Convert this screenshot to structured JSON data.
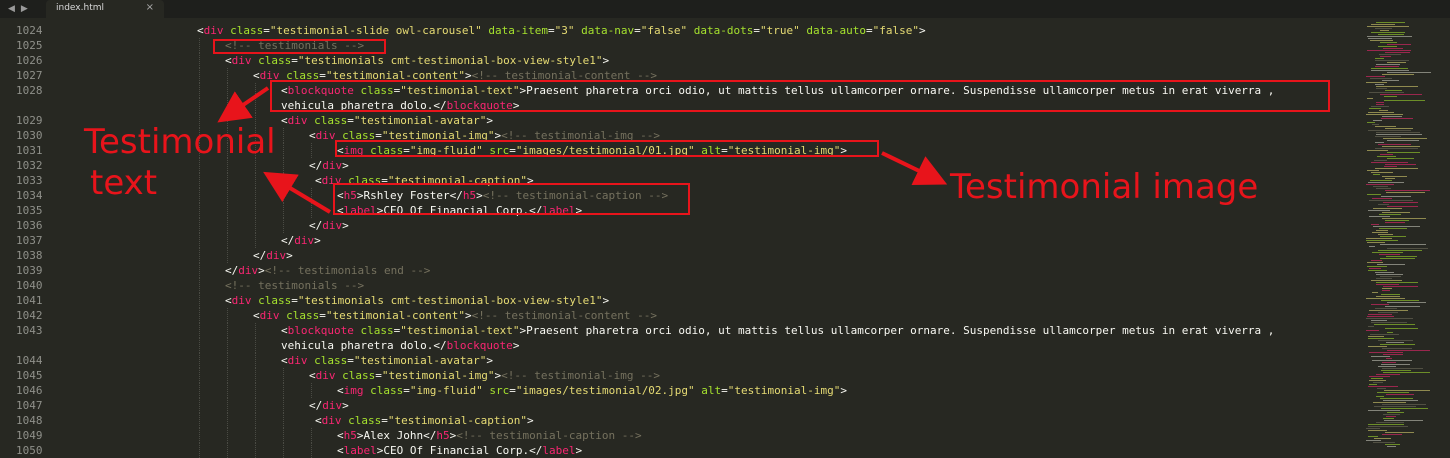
{
  "tab": {
    "title": "index.html",
    "close": "×"
  },
  "nav": {
    "back": "◀",
    "forward": "▶"
  },
  "line_numbers": [
    "1024",
    "1025",
    "1026",
    "1027",
    "1028",
    "1029",
    "1030",
    "1031",
    "1032",
    "1033",
    "1034",
    "1035",
    "1036",
    "1037",
    "1038",
    "1039",
    "1040",
    "1041",
    "1042",
    "1043",
    "1044",
    "1045",
    "1046",
    "1047",
    "1048",
    "1049",
    "1050"
  ],
  "code_lines": [
    {
      "indent": 1,
      "tokens": [
        [
          "t",
          "<"
        ],
        [
          "tag",
          "div"
        ],
        [
          "t",
          " "
        ],
        [
          "attr",
          "class"
        ],
        [
          "t",
          "="
        ],
        [
          "str",
          "\"testimonial-slide owl-carousel\""
        ],
        [
          "t",
          " "
        ],
        [
          "attr",
          "data-item"
        ],
        [
          "t",
          "="
        ],
        [
          "str",
          "\"3\""
        ],
        [
          "t",
          " "
        ],
        [
          "attr",
          "data-nav"
        ],
        [
          "t",
          "="
        ],
        [
          "str",
          "\"false\""
        ],
        [
          "t",
          " "
        ],
        [
          "attr",
          "data-dots"
        ],
        [
          "t",
          "="
        ],
        [
          "str",
          "\"true\""
        ],
        [
          "t",
          " "
        ],
        [
          "attr",
          "data-auto"
        ],
        [
          "t",
          "="
        ],
        [
          "str",
          "\"false\""
        ],
        [
          "t",
          ">"
        ]
      ]
    },
    {
      "indent": 2,
      "tokens": [
        [
          "com",
          "<!-- testimonials -->"
        ]
      ]
    },
    {
      "indent": 2,
      "tokens": [
        [
          "t",
          "<"
        ],
        [
          "tag",
          "div"
        ],
        [
          "t",
          " "
        ],
        [
          "attr",
          "class"
        ],
        [
          "t",
          "="
        ],
        [
          "str",
          "\"testimonials cmt-testimonial-box-view-style1\""
        ],
        [
          "t",
          ">"
        ]
      ]
    },
    {
      "indent": 3,
      "tokens": [
        [
          "t",
          "<"
        ],
        [
          "tag",
          "div"
        ],
        [
          "t",
          " "
        ],
        [
          "attr",
          "class"
        ],
        [
          "t",
          "="
        ],
        [
          "str",
          "\"testimonial-content\""
        ],
        [
          "t",
          ">"
        ],
        [
          "com",
          "<!-- testimonial-content -->"
        ]
      ]
    },
    {
      "indent": 4,
      "tokens": [
        [
          "t",
          "<"
        ],
        [
          "tag",
          "blockquote"
        ],
        [
          "t",
          " "
        ],
        [
          "attr",
          "class"
        ],
        [
          "t",
          "="
        ],
        [
          "str",
          "\"testimonial-text\""
        ],
        [
          "t",
          ">Praesent pharetra orci odio, ut mattis tellus ullamcorper ornare. Suspendisse ullamcorper metus in erat viverra ,"
        ]
      ]
    },
    {
      "indent": 4,
      "wrap": true,
      "tokens": [
        [
          "t",
          "vehicula pharetra dolo.</"
        ],
        [
          "tag",
          "blockquote"
        ],
        [
          "t",
          ">"
        ]
      ]
    },
    {
      "indent": 4,
      "tokens": [
        [
          "t",
          "<"
        ],
        [
          "tag",
          "div"
        ],
        [
          "t",
          " "
        ],
        [
          "attr",
          "class"
        ],
        [
          "t",
          "="
        ],
        [
          "str",
          "\"testimonial-avatar\""
        ],
        [
          "t",
          ">"
        ]
      ]
    },
    {
      "indent": 5,
      "tokens": [
        [
          "t",
          "<"
        ],
        [
          "tag",
          "div"
        ],
        [
          "t",
          " "
        ],
        [
          "attr",
          "class"
        ],
        [
          "t",
          "="
        ],
        [
          "str",
          "\"testimonial-img\""
        ],
        [
          "t",
          ">"
        ],
        [
          "com",
          "<!-- testimonial-img -->"
        ]
      ]
    },
    {
      "indent": 6,
      "tokens": [
        [
          "t",
          "<"
        ],
        [
          "tag",
          "img"
        ],
        [
          "t",
          " "
        ],
        [
          "attr",
          "class"
        ],
        [
          "t",
          "="
        ],
        [
          "str",
          "\"img-fluid\""
        ],
        [
          "t",
          " "
        ],
        [
          "attr",
          "src"
        ],
        [
          "t",
          "="
        ],
        [
          "str",
          "\"images/testimonial/01.jpg\""
        ],
        [
          "t",
          " "
        ],
        [
          "attr",
          "alt"
        ],
        [
          "t",
          "="
        ],
        [
          "str",
          "\"testimonial-img\""
        ],
        [
          "t",
          ">"
        ]
      ]
    },
    {
      "indent": 5,
      "tokens": [
        [
          "t",
          "</"
        ],
        [
          "tag",
          "div"
        ],
        [
          "t",
          ">"
        ]
      ]
    },
    {
      "indent": 5,
      "extra": 6,
      "tokens": [
        [
          "t",
          "<"
        ],
        [
          "tag",
          "div"
        ],
        [
          "t",
          " "
        ],
        [
          "attr",
          "class"
        ],
        [
          "t",
          "="
        ],
        [
          "str",
          "\"testimonial-caption\""
        ],
        [
          "t",
          ">"
        ]
      ]
    },
    {
      "indent": 6,
      "tokens": [
        [
          "t",
          "<"
        ],
        [
          "tag",
          "h5"
        ],
        [
          "t",
          ">Rshley Foster</"
        ],
        [
          "tag",
          "h5"
        ],
        [
          "t",
          ">"
        ],
        [
          "com",
          "<!-- testimonial-caption -->"
        ]
      ]
    },
    {
      "indent": 6,
      "tokens": [
        [
          "t",
          "<"
        ],
        [
          "tag",
          "label"
        ],
        [
          "t",
          ">CEO Of Financial Corp.</"
        ],
        [
          "tag",
          "label"
        ],
        [
          "t",
          ">"
        ]
      ]
    },
    {
      "indent": 5,
      "tokens": [
        [
          "t",
          "</"
        ],
        [
          "tag",
          "div"
        ],
        [
          "t",
          ">"
        ]
      ]
    },
    {
      "indent": 4,
      "tokens": [
        [
          "t",
          "</"
        ],
        [
          "tag",
          "div"
        ],
        [
          "t",
          ">"
        ]
      ]
    },
    {
      "indent": 3,
      "tokens": [
        [
          "t",
          "</"
        ],
        [
          "tag",
          "div"
        ],
        [
          "t",
          ">"
        ]
      ]
    },
    {
      "indent": 2,
      "tokens": [
        [
          "t",
          "</"
        ],
        [
          "tag",
          "div"
        ],
        [
          "t",
          ">"
        ],
        [
          "com",
          "<!-- testimonials end -->"
        ]
      ]
    },
    {
      "indent": 2,
      "tokens": [
        [
          "com",
          "<!-- testimonials -->"
        ]
      ]
    },
    {
      "indent": 2,
      "tokens": [
        [
          "t",
          "<"
        ],
        [
          "tag",
          "div"
        ],
        [
          "t",
          " "
        ],
        [
          "attr",
          "class"
        ],
        [
          "t",
          "="
        ],
        [
          "str",
          "\"testimonials cmt-testimonial-box-view-style1\""
        ],
        [
          "t",
          ">"
        ]
      ]
    },
    {
      "indent": 3,
      "tokens": [
        [
          "t",
          "<"
        ],
        [
          "tag",
          "div"
        ],
        [
          "t",
          " "
        ],
        [
          "attr",
          "class"
        ],
        [
          "t",
          "="
        ],
        [
          "str",
          "\"testimonial-content\""
        ],
        [
          "t",
          ">"
        ],
        [
          "com",
          "<!-- testimonial-content -->"
        ]
      ]
    },
    {
      "indent": 4,
      "tokens": [
        [
          "t",
          "<"
        ],
        [
          "tag",
          "blockquote"
        ],
        [
          "t",
          " "
        ],
        [
          "attr",
          "class"
        ],
        [
          "t",
          "="
        ],
        [
          "str",
          "\"testimonial-text\""
        ],
        [
          "t",
          ">Praesent pharetra orci odio, ut mattis tellus ullamcorper ornare. Suspendisse ullamcorper metus in erat viverra ,"
        ]
      ]
    },
    {
      "indent": 4,
      "wrap": true,
      "tokens": [
        [
          "t",
          "vehicula pharetra dolo.</"
        ],
        [
          "tag",
          "blockquote"
        ],
        [
          "t",
          ">"
        ]
      ]
    },
    {
      "indent": 4,
      "tokens": [
        [
          "t",
          "<"
        ],
        [
          "tag",
          "div"
        ],
        [
          "t",
          " "
        ],
        [
          "attr",
          "class"
        ],
        [
          "t",
          "="
        ],
        [
          "str",
          "\"testimonial-avatar\""
        ],
        [
          "t",
          ">"
        ]
      ]
    },
    {
      "indent": 5,
      "tokens": [
        [
          "t",
          "<"
        ],
        [
          "tag",
          "div"
        ],
        [
          "t",
          " "
        ],
        [
          "attr",
          "class"
        ],
        [
          "t",
          "="
        ],
        [
          "str",
          "\"testimonial-img\""
        ],
        [
          "t",
          ">"
        ],
        [
          "com",
          "<!-- testimonial-img -->"
        ]
      ]
    },
    {
      "indent": 6,
      "tokens": [
        [
          "t",
          "<"
        ],
        [
          "tag",
          "img"
        ],
        [
          "t",
          " "
        ],
        [
          "attr",
          "class"
        ],
        [
          "t",
          "="
        ],
        [
          "str",
          "\"img-fluid\""
        ],
        [
          "t",
          " "
        ],
        [
          "attr",
          "src"
        ],
        [
          "t",
          "="
        ],
        [
          "str",
          "\"images/testimonial/02.jpg\""
        ],
        [
          "t",
          " "
        ],
        [
          "attr",
          "alt"
        ],
        [
          "t",
          "="
        ],
        [
          "str",
          "\"testimonial-img\""
        ],
        [
          "t",
          ">"
        ]
      ]
    },
    {
      "indent": 5,
      "tokens": [
        [
          "t",
          "</"
        ],
        [
          "tag",
          "div"
        ],
        [
          "t",
          ">"
        ]
      ]
    },
    {
      "indent": 5,
      "extra": 6,
      "tokens": [
        [
          "t",
          "<"
        ],
        [
          "tag",
          "div"
        ],
        [
          "t",
          " "
        ],
        [
          "attr",
          "class"
        ],
        [
          "t",
          "="
        ],
        [
          "str",
          "\"testimonial-caption\""
        ],
        [
          "t",
          ">"
        ]
      ]
    },
    {
      "indent": 6,
      "tokens": [
        [
          "t",
          "<"
        ],
        [
          "tag",
          "h5"
        ],
        [
          "t",
          ">Alex John</"
        ],
        [
          "tag",
          "h5"
        ],
        [
          "t",
          ">"
        ],
        [
          "com",
          "<!-- testimonial-caption -->"
        ]
      ]
    },
    {
      "indent": 6,
      "tokens": [
        [
          "t",
          "<"
        ],
        [
          "tag",
          "label"
        ],
        [
          "t",
          ">CEO Of Financial Corp.</"
        ],
        [
          "tag",
          "label"
        ],
        [
          "t",
          ">"
        ]
      ]
    }
  ],
  "annotations": {
    "testimonial_text_line1": "Testimonial",
    "testimonial_text_line2": "text",
    "testimonial_image": "Testimonial image",
    "color": "#e8141b"
  },
  "theme": {
    "background": "#272822",
    "tag": "#f92672",
    "attribute": "#a6e22e",
    "string": "#e6db74",
    "comment": "#75715e",
    "text": "#f8f8f2"
  }
}
